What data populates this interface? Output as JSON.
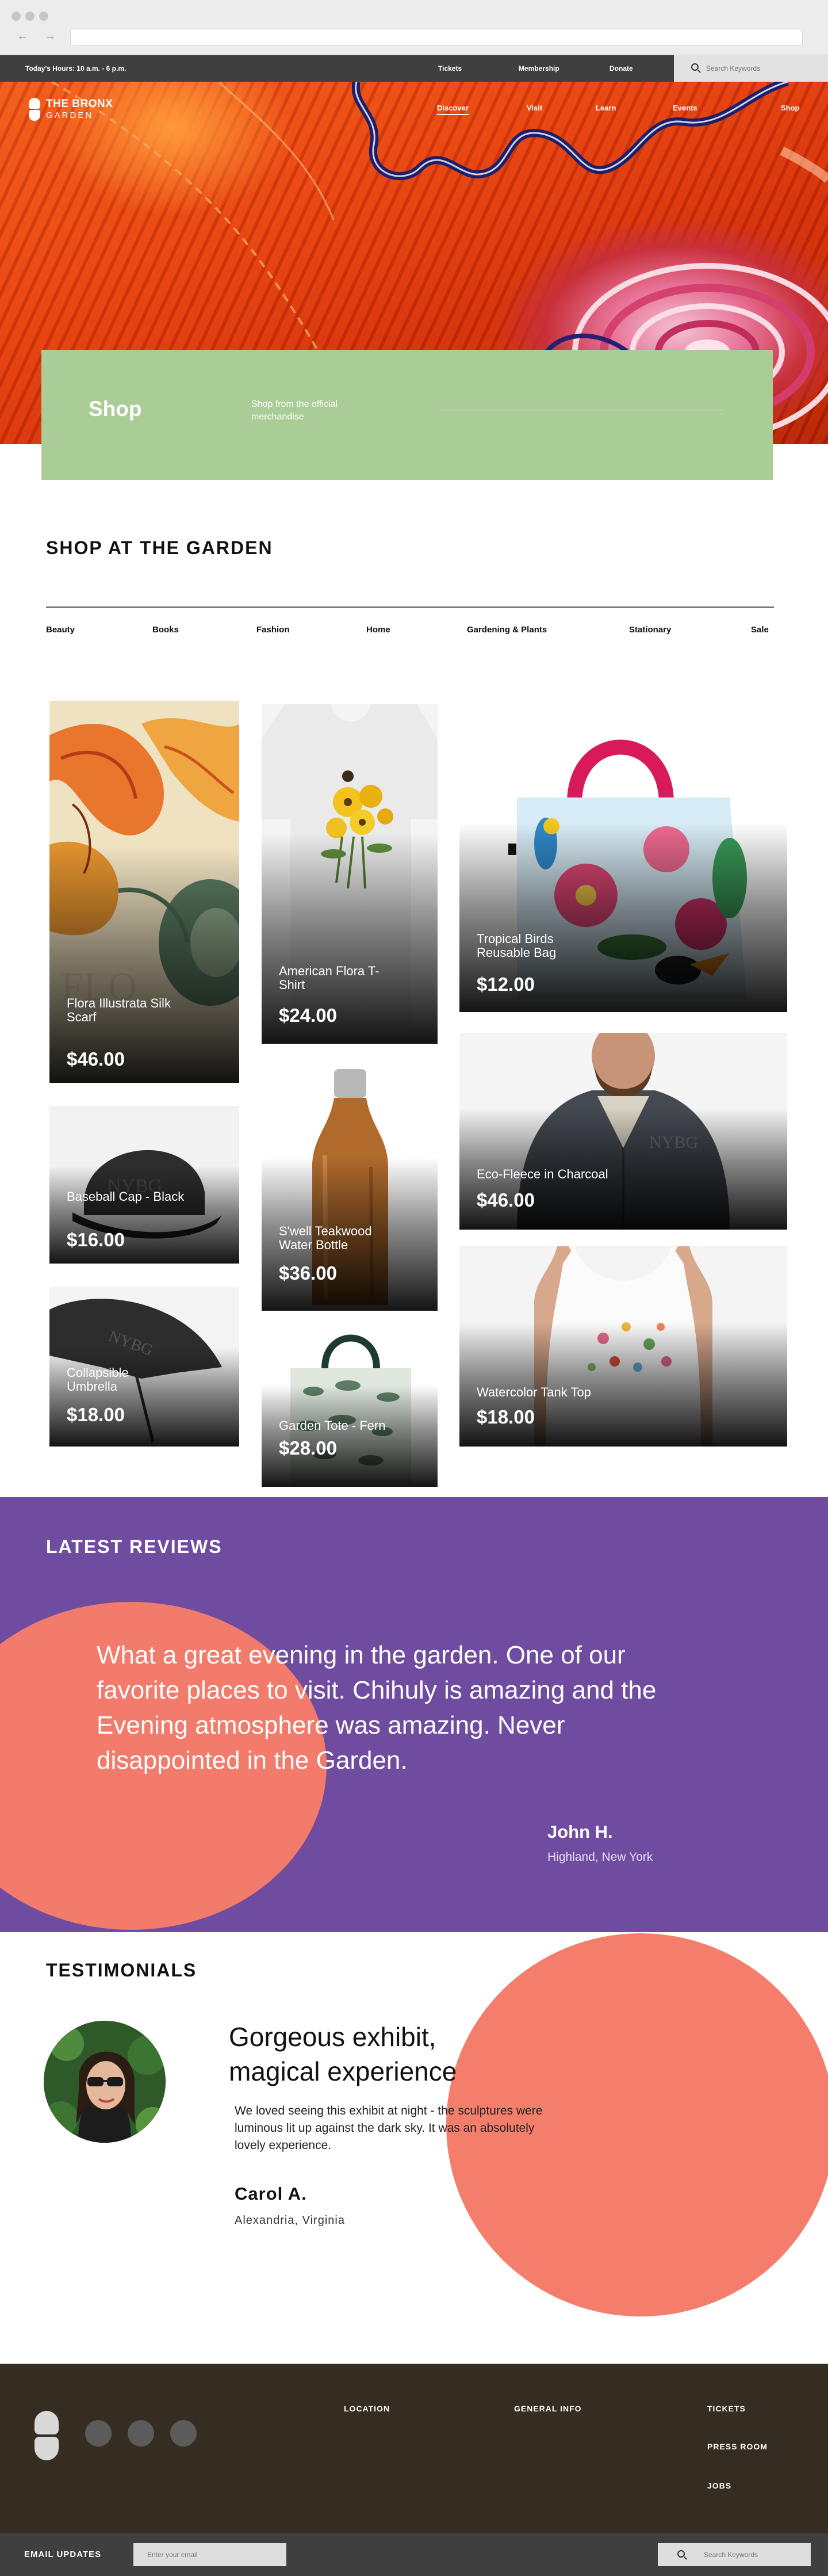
{
  "utility_bar": {
    "hours": "Today's Hours: 10 a.m. - 6 p.m.",
    "links": [
      "Tickets",
      "Membership",
      "Donate"
    ],
    "search_placeholder": "Search Keywords"
  },
  "header": {
    "logo_line1": "THE BRONX",
    "logo_line2": "GARDEN",
    "nav": [
      "Discover",
      "Visit",
      "Learn",
      "Events",
      "Shop"
    ],
    "active_nav": "Discover"
  },
  "shop_banner": {
    "title": "Shop",
    "description": "Shop from the official merchandise",
    "color": "#aacd97"
  },
  "shop_section": {
    "heading": "SHOP AT THE GARDEN",
    "categories": [
      "Beauty",
      "Books",
      "Fashion",
      "Home",
      "Gardening & Plants",
      "Stationary",
      "Sale"
    ],
    "products": [
      {
        "name": "Flora Illustrata Silk Scarf",
        "price": "$46.00"
      },
      {
        "name": "American Flora T-Shirt",
        "price": "$24.00"
      },
      {
        "name": "Tropical Birds Reusable Bag",
        "price": "$12.00"
      },
      {
        "name": "Baseball Cap - Black",
        "price": "$16.00"
      },
      {
        "name": "S'well Teakwood Water Bottle",
        "price": "$36.00"
      },
      {
        "name": "Eco-Fleece in Charcoal",
        "price": "$46.00"
      },
      {
        "name": "Collapsible Umbrella",
        "price": "$18.00"
      },
      {
        "name": "Garden Tote - Fern",
        "price": "$28.00"
      },
      {
        "name": "Watercolor Tank Top",
        "price": "$18.00"
      }
    ],
    "product_print": "NYBG"
  },
  "reviews": {
    "heading": "LATEST REVIEWS",
    "quote": "What a great evening in the garden. One of our favorite places to visit. Chihuly is amazing and the Evening atmosphere was amazing. Never disappointed in the Garden.",
    "author": "John H.",
    "location": "Highland, New York",
    "background_color": "#6f4ca0",
    "accent_color": "#f27b6b"
  },
  "testimonials": {
    "heading": "TESTIMONIALS",
    "title": "Gorgeous exhibit, magical experience",
    "body": "We loved seeing this exhibit at night - the sculptures were luminous lit up against the dark sky. It was an absolutely lovely experience.",
    "author": "Carol A.",
    "location": "Alexandria, Virginia"
  },
  "footer": {
    "columns": [
      "LOCATION",
      "GENERAL INFO"
    ],
    "links": [
      "TICKETS",
      "PRESS ROOM",
      "JOBS"
    ],
    "email_label": "EMAIL UPDATES",
    "email_placeholder": "Enter your email",
    "search_placeholder": "Search Keywords",
    "background_color": "#352d22"
  }
}
